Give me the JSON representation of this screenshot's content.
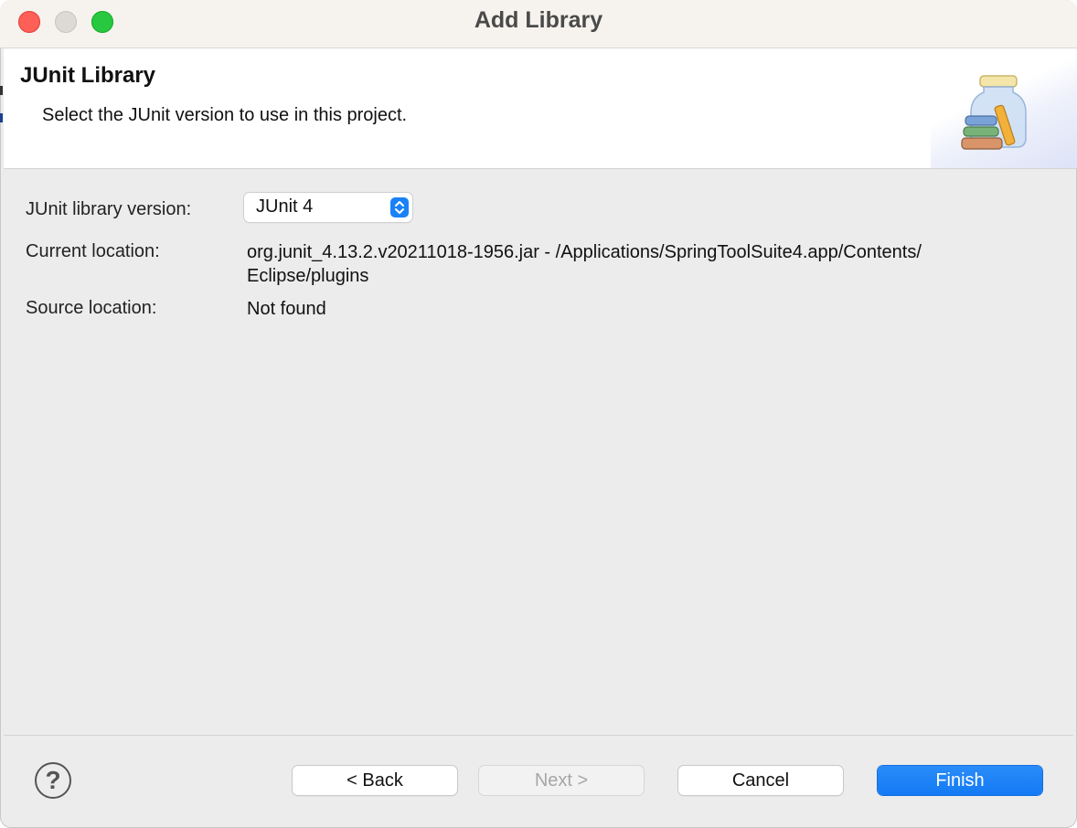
{
  "window": {
    "title": "Add Library"
  },
  "header": {
    "title": "JUnit Library",
    "description": "Select the JUnit version to use in this project.",
    "icon": "library-jar-icon"
  },
  "form": {
    "version_label": "JUnit library version:",
    "version_value": "JUnit 4",
    "location_label": "Current location:",
    "location_line1": "org.junit_4.13.2.v20211018-1956.jar - /Applications/SpringToolSuite4.app/Contents/",
    "location_line2": "Eclipse/plugins",
    "source_label": "Source location:",
    "source_value": "Not found"
  },
  "buttons": {
    "help": "?",
    "back": "< Back",
    "next": "Next >",
    "cancel": "Cancel",
    "finish": "Finish"
  },
  "colors": {
    "accent": "#1a82f7",
    "close": "#fe5f57",
    "minimize": "#dcd9d6",
    "zoom": "#28c840"
  }
}
